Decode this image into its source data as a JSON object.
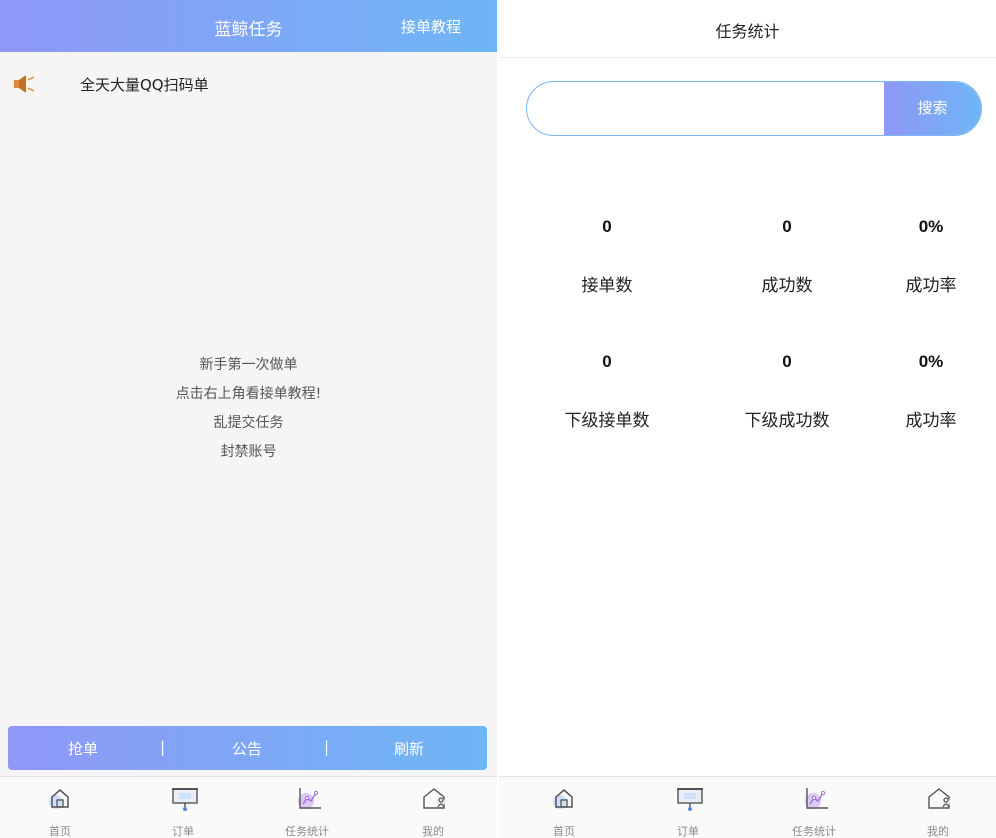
{
  "left": {
    "header": {
      "title": "蓝鲸任务",
      "tutorial_link": "接单教程"
    },
    "notice": {
      "icon": "speaker-icon",
      "text": "全天大量QQ扫码单"
    },
    "center_message": [
      "新手第一次做单",
      "点击右上角看接单教程!",
      "乱提交任务",
      "封禁账号"
    ],
    "action_bar": {
      "grab": "抢单",
      "announcement": "公告",
      "refresh": "刷新",
      "separator": "|"
    }
  },
  "right": {
    "header": {
      "title": "任务统计"
    },
    "search": {
      "value": "",
      "placeholder": "",
      "button": "搜索"
    },
    "stats": {
      "row1": [
        {
          "value": "0",
          "label": "接单数"
        },
        {
          "value": "0",
          "label": "成功数"
        },
        {
          "value": "0%",
          "label": "成功率"
        }
      ],
      "row2": [
        {
          "value": "0",
          "label": "下级接单数"
        },
        {
          "value": "0",
          "label": "下级成功数"
        },
        {
          "value": "0%",
          "label": "成功率"
        }
      ]
    }
  },
  "tabbar": {
    "items": [
      {
        "label": "首页",
        "icon": "home-icon"
      },
      {
        "label": "订单",
        "icon": "order-icon"
      },
      {
        "label": "任务统计",
        "icon": "chart-icon"
      },
      {
        "label": "我的",
        "icon": "profile-icon"
      }
    ]
  },
  "colors": {
    "accent_start": "#8f97f7",
    "accent_end": "#6eb6f5"
  }
}
